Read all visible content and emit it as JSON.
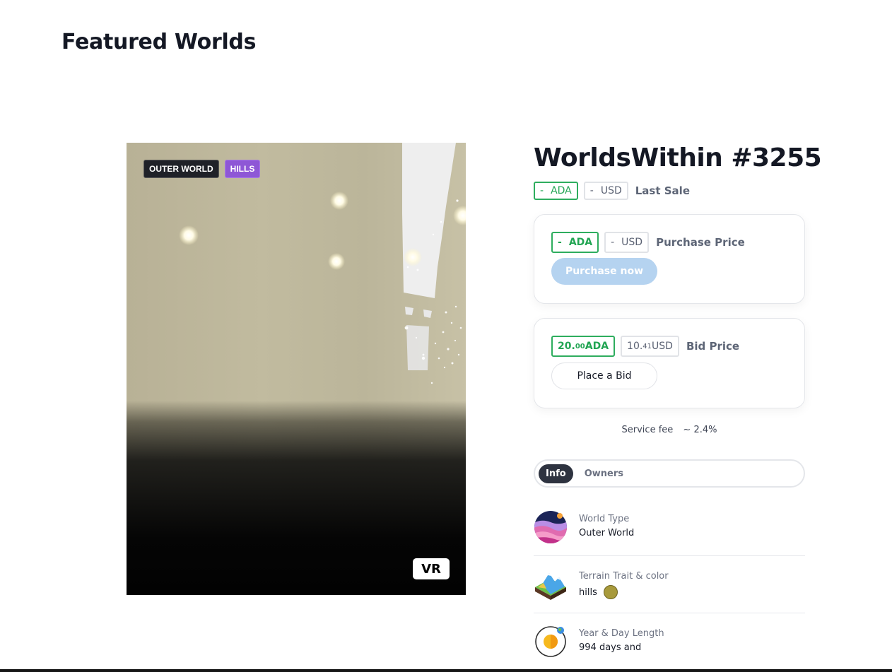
{
  "page": {
    "title": "Featured Worlds"
  },
  "media": {
    "tags": [
      {
        "label": "OUTER WORLD",
        "color": "#1f2128"
      },
      {
        "label": "HILLS",
        "color": "#8e57d6"
      }
    ],
    "vr_label": "VR"
  },
  "nft": {
    "title": "WorldsWithin #3255"
  },
  "last_sale": {
    "ada_dash": "-",
    "ada_unit": "ADA",
    "usd_dash": "-",
    "usd_unit": "USD",
    "label": "Last Sale"
  },
  "purchase": {
    "ada_dash": "-",
    "ada_unit": "ADA",
    "usd_dash": "-",
    "usd_unit": "USD",
    "label": "Purchase Price",
    "button": "Purchase now"
  },
  "bid": {
    "ada_whole": "20.",
    "ada_frac": "00",
    "ada_unit": " ADA",
    "usd_whole": "10.",
    "usd_frac": "41",
    "usd_unit": " USD",
    "label": "Bid Price",
    "button": "Place a Bid"
  },
  "service_fee": {
    "label": "Service fee",
    "value": "~ 2.4%"
  },
  "tabs": [
    {
      "label": "Info",
      "active": true
    },
    {
      "label": "Owners",
      "active": false
    }
  ],
  "info": {
    "world_type": {
      "label": "World Type",
      "value": "Outer World",
      "icon": "planet-icon"
    },
    "terrain": {
      "label": "Terrain Trait & color",
      "value": "hills",
      "color": "#a89a3c",
      "icon": "terrain-icon"
    },
    "year_day": {
      "label": "Year & Day Length",
      "value": "994 days and",
      "icon": "orbit-icon"
    }
  },
  "colors": {
    "accent_green": "#22a553",
    "button_disabled": "#b5d3f0",
    "tab_active": "#2e3340"
  }
}
